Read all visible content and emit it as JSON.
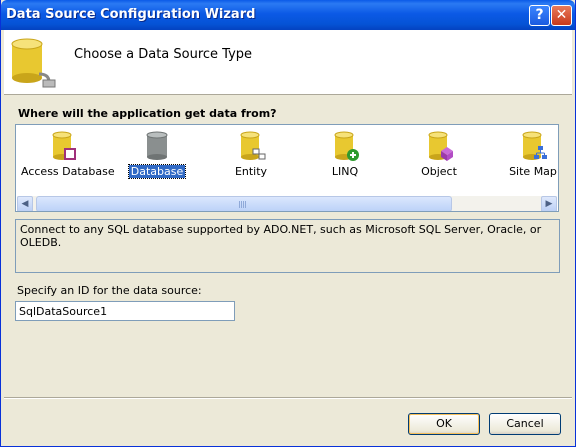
{
  "window": {
    "title": "Data Source Configuration Wizard",
    "help_glyph": "?",
    "close_glyph": "✕"
  },
  "header": {
    "title": "Choose a Data Source Type"
  },
  "prompt": "Where will the application get data from?",
  "types": [
    {
      "label": "Access Database",
      "icon": "access-database-icon",
      "selected": false
    },
    {
      "label": "Database",
      "icon": "database-icon",
      "selected": true
    },
    {
      "label": "Entity",
      "icon": "entity-icon",
      "selected": false
    },
    {
      "label": "LINQ",
      "icon": "linq-icon",
      "selected": false
    },
    {
      "label": "Object",
      "icon": "object-icon",
      "selected": false
    },
    {
      "label": "Site Map",
      "icon": "site-map-icon",
      "selected": false
    }
  ],
  "scrollbar": {
    "left_glyph": "◀",
    "right_glyph": "▶"
  },
  "description": "Connect to any SQL database supported by ADO.NET, such as Microsoft SQL Server, Oracle, or OLEDB.",
  "id_field": {
    "label": "Specify an ID for the data source:",
    "value": "SqlDataSource1"
  },
  "buttons": {
    "ok": "OK",
    "cancel": "Cancel"
  },
  "colors": {
    "titlebar": "#0553d6",
    "selection": "#316ac5",
    "dialog_bg": "#ece9d8"
  }
}
